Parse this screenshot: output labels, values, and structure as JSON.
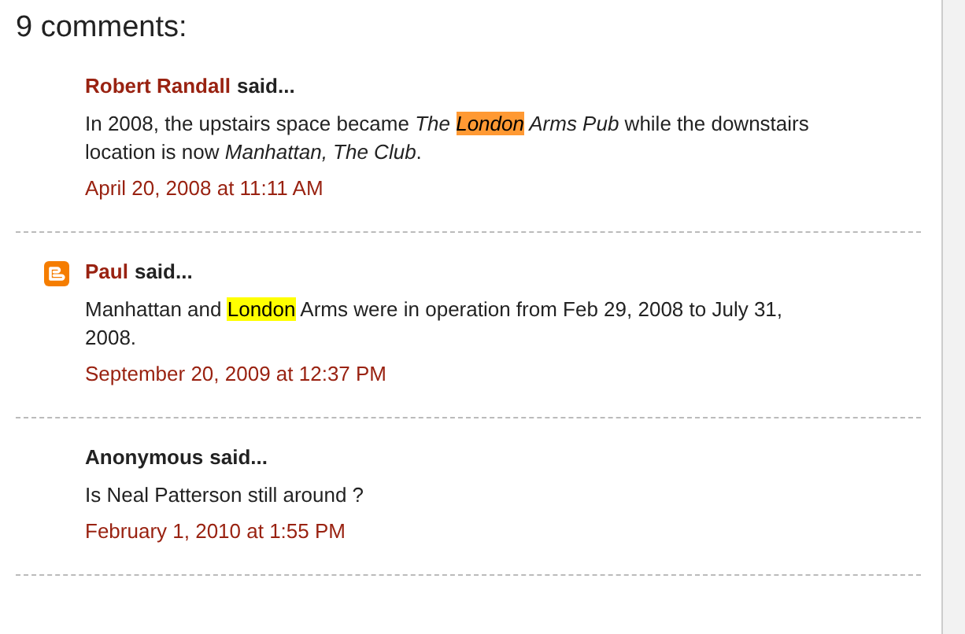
{
  "heading": "9 comments:",
  "comments": [
    {
      "author": "Robert Randall",
      "author_link": true,
      "kind": "plain",
      "said": "said...",
      "body": [
        {
          "text": "In 2008, the upstairs space became ",
          "italic": false
        },
        {
          "text": "The ",
          "italic": true
        },
        {
          "text": "London",
          "italic": true,
          "color": "#ff9933"
        },
        {
          "text": " Arms Pub",
          "italic": true
        },
        {
          "text": " while the downstairs location is now ",
          "italic": false
        },
        {
          "text": "Manhattan, The Club",
          "italic": true
        },
        {
          "text": ".",
          "italic": false
        }
      ],
      "date": "April 20, 2008 at 11:11 AM"
    },
    {
      "author": "Paul",
      "author_link": true,
      "kind": "blogger",
      "said": "said...",
      "body": [
        {
          "text": "Manhattan and ",
          "italic": false
        },
        {
          "text": "London",
          "italic": false,
          "color": "#ffff00"
        },
        {
          "text": " Arms were in operation from Feb 29, 2008 to July 31, 2008.",
          "italic": false
        }
      ],
      "date": "September 20, 2009 at 12:37 PM"
    },
    {
      "author": "Anonymous",
      "author_link": false,
      "kind": "plain",
      "said": "said...",
      "body": [
        {
          "text": "Is Neal Patterson still around ?",
          "italic": false
        }
      ],
      "date": "February 1, 2010 at 1:55 PM"
    }
  ]
}
